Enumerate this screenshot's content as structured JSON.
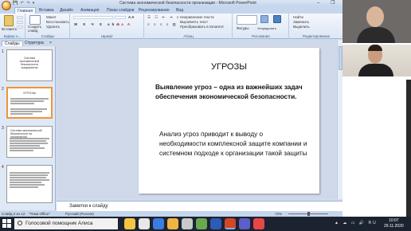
{
  "window": {
    "title": "Система экономической безопасности организации - Microsoft PowerPoint",
    "controls": "– ❐ ✕"
  },
  "ribbon": {
    "tabs": [
      "Главная",
      "Вставка",
      "Дизайн",
      "Анимация",
      "Показ слайдов",
      "Рецензирование",
      "Вид"
    ],
    "groups": {
      "clipboard": {
        "label": "Буфер о...",
        "paste": "Вставить"
      },
      "slides": {
        "label": "Слайды",
        "create": "Создать слайд",
        "layout": "Макет",
        "reset": "Восстановить",
        "delete": "Удалить"
      },
      "font": {
        "label": "Шрифт"
      },
      "paragraph": {
        "label": "Абзац",
        "direction": "Направление текста",
        "align": "Выровнять текст",
        "smartart": "Преобразовать в SmartArt"
      },
      "drawing": {
        "label": "Рисование",
        "shapes": "Фигуры",
        "arrange": "Упорядочить",
        "styles": "Экспресс-стили"
      },
      "editing": {
        "label": "Редактирование",
        "find": "Найти",
        "replace": "Заменить",
        "select": "Выделить"
      }
    }
  },
  "panel": {
    "tab_slides": "Слайды",
    "tab_outline": "Структура",
    "close": "×",
    "thumbnails": [
      {
        "num": "1",
        "title": "Система экономической безопасности предприятия"
      },
      {
        "num": "2",
        "title": "УГРОЗЫ"
      },
      {
        "num": "3",
        "title": "Система экономической безопасности на предприятии"
      },
      {
        "num": "4",
        "title": ""
      }
    ]
  },
  "slide": {
    "title": "УГРОЗЫ",
    "para1": "Выявление угроз – одна из важнейших задач обеспечения экономической безопасности.",
    "para2": "Анализ угроз приводит к выводу о необходимости комплексной защите компании и системном подходе к организации такой защиты"
  },
  "notes": {
    "text": "Заметки к слайду"
  },
  "status": {
    "slide": "Слайд 2 из 12",
    "theme": "\"Тема Office\"",
    "lang": "Русский (Россия)",
    "zoom": "72%"
  },
  "taskbar": {
    "search_text": "Голосовой помощник Алиса",
    "tray": "RU",
    "clock_time": "10:07",
    "clock_date": "29.11.2020"
  },
  "colors": {
    "accent": "#f29436",
    "ribbon": "#dce7f5",
    "taskbar": "#1c2330"
  }
}
